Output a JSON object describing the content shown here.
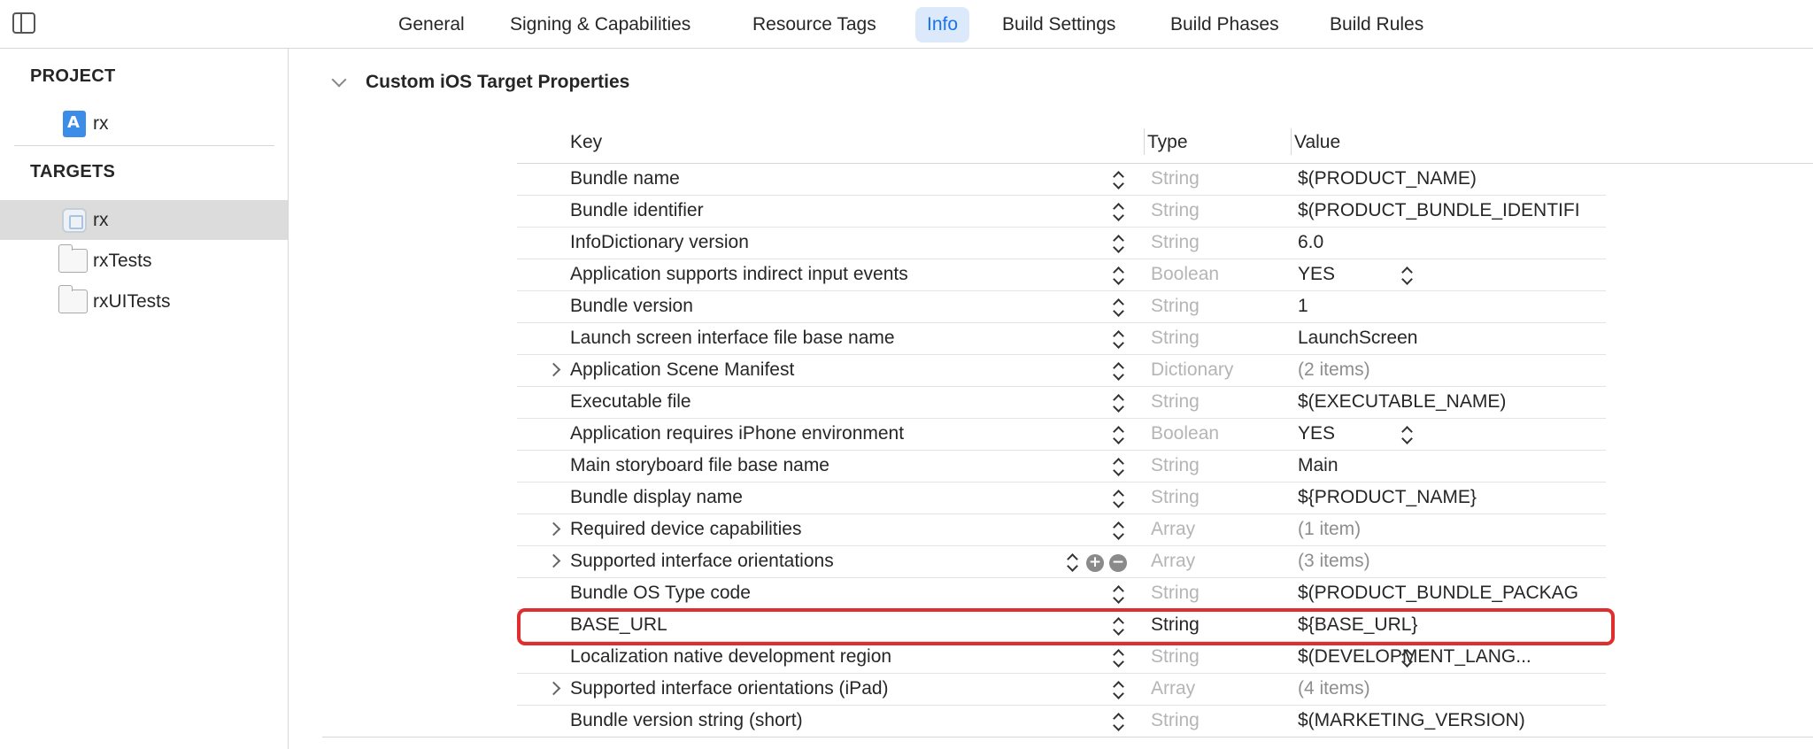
{
  "tabs": [
    {
      "label": "General",
      "active": false
    },
    {
      "label": "Signing & Capabilities",
      "active": false
    },
    {
      "label": "Resource Tags",
      "active": false
    },
    {
      "label": "Info",
      "active": true
    },
    {
      "label": "Build Settings",
      "active": false
    },
    {
      "label": "Build Phases",
      "active": false
    },
    {
      "label": "Build Rules",
      "active": false
    }
  ],
  "sidebar": {
    "project_title": "PROJECT",
    "project_item": "rx",
    "targets_title": "TARGETS",
    "targets": [
      "rx",
      "rxTests",
      "rxUITests"
    ],
    "selected_target": "rx"
  },
  "section": {
    "title": "Custom iOS Target Properties"
  },
  "table": {
    "headers": {
      "key": "Key",
      "type": "Type",
      "value": "Value"
    },
    "rows": [
      {
        "key": "Bundle name",
        "type": "String",
        "value": "$(PRODUCT_NAME)",
        "expandable": false
      },
      {
        "key": "Bundle identifier",
        "type": "String",
        "value": "$(PRODUCT_BUNDLE_IDENTIFI",
        "expandable": false
      },
      {
        "key": "InfoDictionary version",
        "type": "String",
        "value": "6.0",
        "expandable": false
      },
      {
        "key": "Application supports indirect input events",
        "type": "Boolean",
        "value": "YES",
        "expandable": false,
        "value_stepper": true
      },
      {
        "key": "Bundle version",
        "type": "String",
        "value": "1",
        "expandable": false
      },
      {
        "key": "Launch screen interface file base name",
        "type": "String",
        "value": "LaunchScreen",
        "expandable": false
      },
      {
        "key": "Application Scene Manifest",
        "type": "Dictionary",
        "value": "(2 items)",
        "expandable": true
      },
      {
        "key": "Executable file",
        "type": "String",
        "value": "$(EXECUTABLE_NAME)",
        "expandable": false
      },
      {
        "key": "Application requires iPhone environment",
        "type": "Boolean",
        "value": "YES",
        "expandable": false,
        "value_stepper": true
      },
      {
        "key": "Main storyboard file base name",
        "type": "String",
        "value": "Main",
        "expandable": false
      },
      {
        "key": "Bundle display name",
        "type": "String",
        "value": "${PRODUCT_NAME}",
        "expandable": false
      },
      {
        "key": "Required device capabilities",
        "type": "Array",
        "value": "(1 item)",
        "expandable": true
      },
      {
        "key": "Supported interface orientations",
        "type": "Array",
        "value": "(3 items)",
        "expandable": true,
        "hovered": true
      },
      {
        "key": "Bundle OS Type code",
        "type": "String",
        "value": "$(PRODUCT_BUNDLE_PACKAG",
        "expandable": false
      },
      {
        "key": "BASE_URL",
        "type": "String",
        "value": "${BASE_URL}",
        "expandable": false,
        "highlighted": true
      },
      {
        "key": "Localization native development region",
        "type": "String",
        "value": "$(DEVELOPMENT_LANG...",
        "expandable": false,
        "value_stepper": true
      },
      {
        "key": "Supported interface orientations (iPad)",
        "type": "Array",
        "value": "(4 items)",
        "expandable": true
      },
      {
        "key": "Bundle version string (short)",
        "type": "String",
        "value": "$(MARKETING_VERSION)",
        "expandable": false
      }
    ]
  },
  "colors": {
    "accent": "#1a73e8",
    "highlight_border": "#e02d2d",
    "selected_bg": "#dcdcdc"
  }
}
